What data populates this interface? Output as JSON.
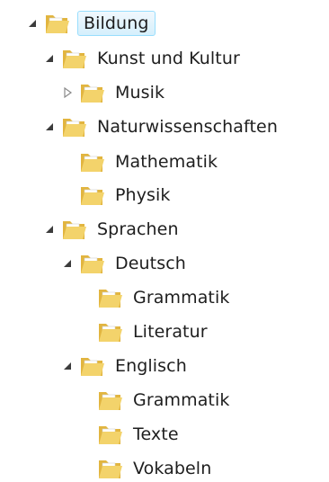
{
  "tree": {
    "items": [
      {
        "label": "Bildung",
        "state": "expanded",
        "selected": true
      },
      {
        "label": "Kunst und Kultur",
        "state": "expanded"
      },
      {
        "label": "Musik",
        "state": "collapsed"
      },
      {
        "label": "Naturwissenschaften",
        "state": "expanded"
      },
      {
        "label": "Mathematik",
        "state": "leaf"
      },
      {
        "label": "Physik",
        "state": "leaf"
      },
      {
        "label": "Sprachen",
        "state": "expanded"
      },
      {
        "label": "Deutsch",
        "state": "expanded"
      },
      {
        "label": "Grammatik",
        "state": "leaf"
      },
      {
        "label": "Literatur",
        "state": "leaf"
      },
      {
        "label": "Englisch",
        "state": "expanded"
      },
      {
        "label": "Grammatik",
        "state": "leaf"
      },
      {
        "label": "Texte",
        "state": "leaf"
      },
      {
        "label": "Vokabeln",
        "state": "leaf"
      }
    ]
  },
  "colors": {
    "folder_front": "#f3d36b",
    "folder_back": "#e2b53f",
    "folder_paper": "#ffffff",
    "toggle_expanded": "#3c3c3c",
    "toggle_collapsed": "#8a8a8a",
    "selection_border": "#99defd"
  },
  "icons": {
    "folder": "folder-icon",
    "expanded": "triangle-expanded-icon",
    "collapsed": "triangle-collapsed-icon"
  }
}
